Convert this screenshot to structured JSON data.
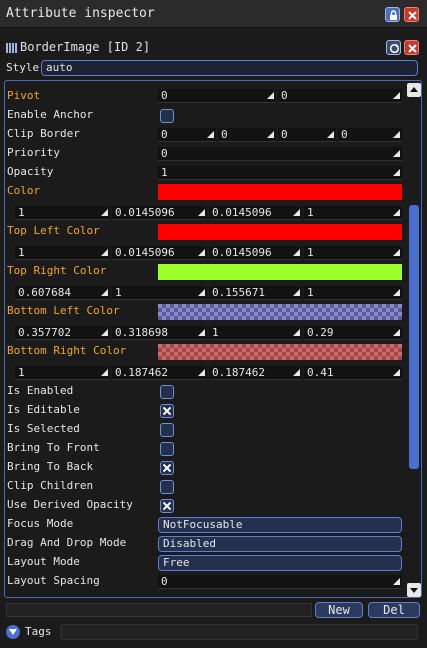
{
  "window": {
    "title": "Attribute inspector"
  },
  "element": {
    "name": "BorderImage [ID 2]"
  },
  "style": {
    "label": "Style",
    "value": "auto"
  },
  "attributes": {
    "pivot": {
      "label": "Pivot",
      "x": "0",
      "y": "0"
    },
    "enable_anchor": {
      "label": "Enable Anchor",
      "checked": false
    },
    "clip_border": {
      "label": "Clip Border",
      "v1": "0",
      "v2": "0",
      "v3": "0",
      "v4": "0"
    },
    "priority": {
      "label": "Priority",
      "value": "0"
    },
    "opacity": {
      "label": "Opacity",
      "value": "1"
    },
    "color": {
      "label": "Color",
      "swatch": "#ff0000",
      "r": "1",
      "g": "0.0145096",
      "b": "0.0145096",
      "a": "1"
    },
    "top_left_color": {
      "label": "Top Left Color",
      "swatch": "#ff0000",
      "r": "1",
      "g": "0.0145096",
      "b": "0.0145096",
      "a": "1"
    },
    "top_right_color": {
      "label": "Top Right Color",
      "swatch": "#9bff28",
      "r": "0.607684",
      "g": "1",
      "b": "0.155671",
      "a": "1"
    },
    "bottom_left_color": {
      "label": "Bottom Left Color",
      "r": "0.357702",
      "g": "0.318698",
      "b": "1",
      "a": "0.29"
    },
    "bottom_right_color": {
      "label": "Bottom Right Color",
      "r": "1",
      "g": "0.187462",
      "b": "0.187462",
      "a": "0.41"
    },
    "is_enabled": {
      "label": "Is Enabled",
      "checked": false
    },
    "is_editable": {
      "label": "Is Editable",
      "checked": true
    },
    "is_selected": {
      "label": "Is Selected",
      "checked": false
    },
    "bring_to_front": {
      "label": "Bring To Front",
      "checked": false
    },
    "bring_to_back": {
      "label": "Bring To Back",
      "checked": true
    },
    "clip_children": {
      "label": "Clip Children",
      "checked": false
    },
    "use_derived_opacity": {
      "label": "Use Derived Opacity",
      "checked": true
    },
    "focus_mode": {
      "label": "Focus Mode",
      "value": "NotFocusable"
    },
    "drag_drop_mode": {
      "label": "Drag And Drop Mode",
      "value": "Disabled"
    },
    "layout_mode": {
      "label": "Layout Mode",
      "value": "Free"
    },
    "layout_spacing": {
      "label": "Layout Spacing",
      "value": "0"
    }
  },
  "buttons": {
    "new": "New",
    "del": "Del"
  },
  "tags": {
    "label": "Tags"
  },
  "colors": {
    "accent": "#4a6fd0",
    "label_highlight": "#f5a623",
    "close_red": "#c43a2e"
  }
}
